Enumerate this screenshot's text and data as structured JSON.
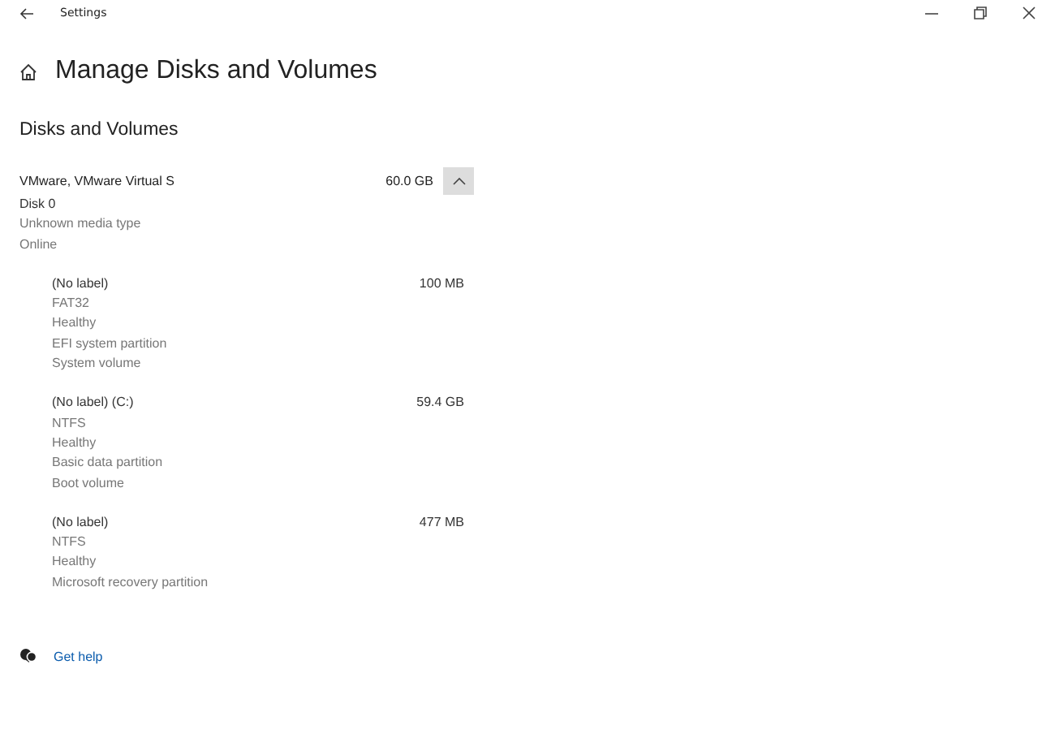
{
  "window": {
    "title": "Settings"
  },
  "page": {
    "title": "Manage Disks and Volumes"
  },
  "section": {
    "title": "Disks and Volumes"
  },
  "disk": {
    "name": "VMware, VMware Virtual S",
    "size": "60.0 GB",
    "expanded": true,
    "details": [
      "Disk 0",
      "Unknown media type",
      "Online"
    ],
    "volumes": [
      {
        "label": "(No label)",
        "size": "100 MB",
        "details": [
          "FAT32",
          "Healthy",
          "EFI system partition",
          "System volume"
        ]
      },
      {
        "label": "(No label) (C:)",
        "size": "59.4 GB",
        "details": [
          "NTFS",
          "Healthy",
          "Basic data partition",
          "Boot volume"
        ]
      },
      {
        "label": "(No label)",
        "size": "477 MB",
        "details": [
          "NTFS",
          "Healthy",
          "Microsoft recovery partition"
        ]
      }
    ]
  },
  "help": {
    "label": "Get help"
  }
}
